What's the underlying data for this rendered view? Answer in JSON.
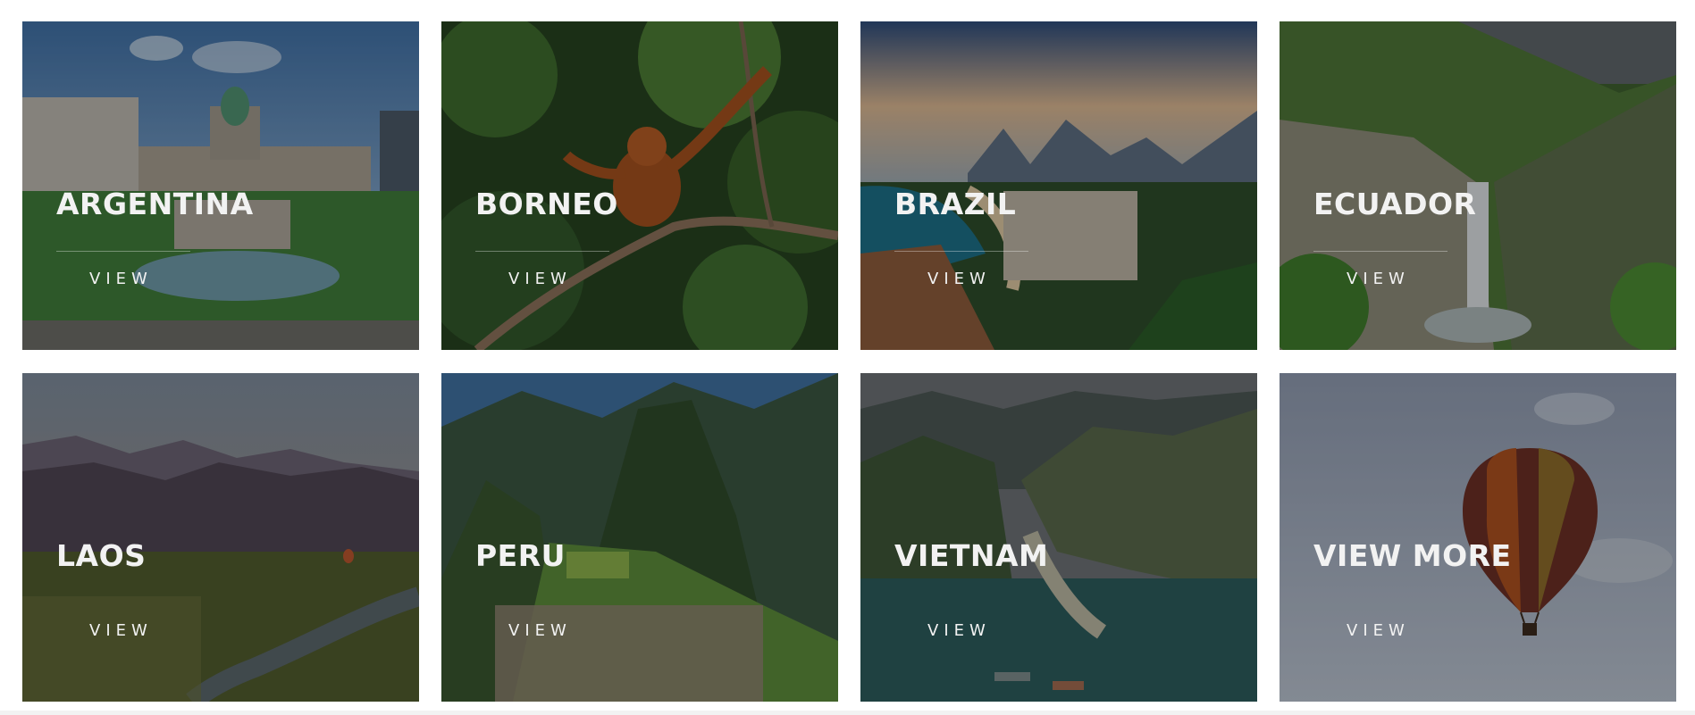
{
  "destinations": [
    {
      "title": "ARGENTINA",
      "link": "VIEW",
      "scene": "city-plaza"
    },
    {
      "title": "BORNEO",
      "link": "VIEW",
      "scene": "jungle-orangutan"
    },
    {
      "title": "BRAZIL",
      "link": "VIEW",
      "scene": "coastal-city-mountains"
    },
    {
      "title": "ECUADOR",
      "link": "VIEW",
      "scene": "waterfall-canyon"
    },
    {
      "title": "LAOS",
      "link": "VIEW",
      "scene": "misty-valley-river"
    },
    {
      "title": "PERU",
      "link": "VIEW",
      "scene": "mountain-ruins"
    },
    {
      "title": "VIETNAM",
      "link": "VIEW",
      "scene": "limestone-bay"
    },
    {
      "title": "VIEW MORE",
      "link": "VIEW",
      "scene": "hot-air-balloon"
    }
  ],
  "colors": {
    "text": "#f2f2f2",
    "overlay": "rgba(0,0,0,0.28)"
  }
}
